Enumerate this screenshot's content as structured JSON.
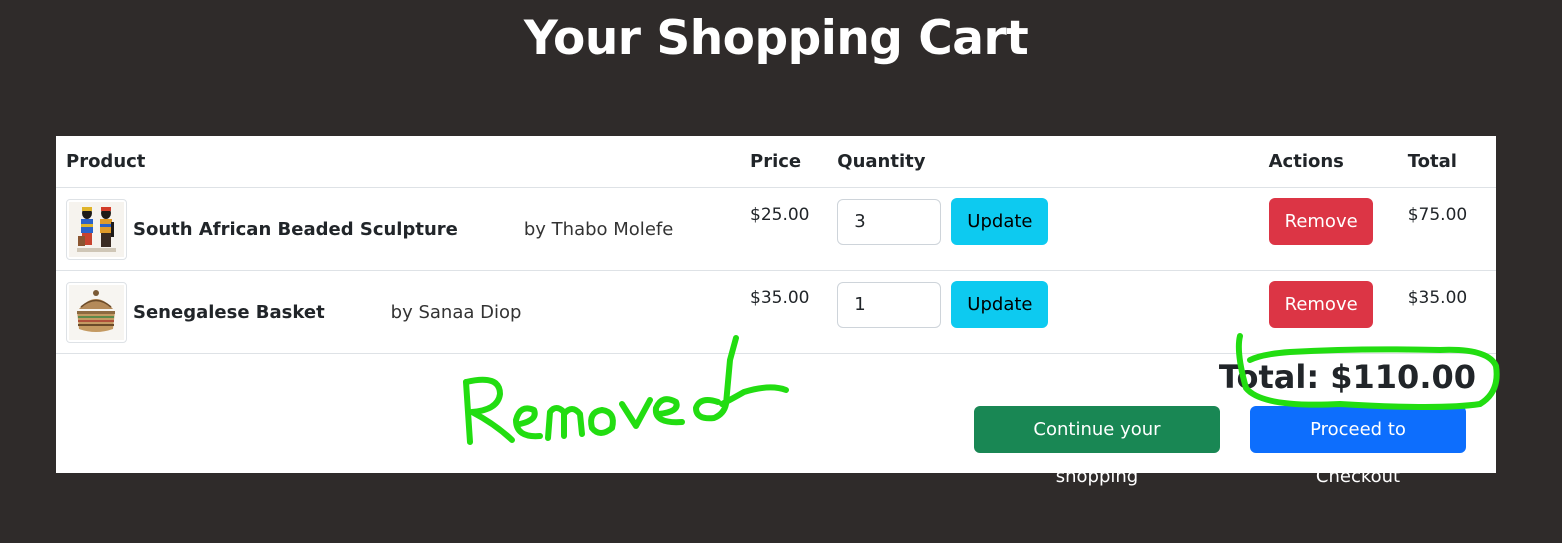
{
  "page": {
    "title": "Your Shopping Cart"
  },
  "table": {
    "headers": {
      "product": "Product",
      "price": "Price",
      "quantity": "Quantity",
      "actions": "Actions",
      "total": "Total"
    },
    "items": [
      {
        "name": "South African Beaded Sculpture",
        "author": "by Thabo Molefe",
        "price": "$25.00",
        "quantity": "3",
        "update_label": "Update",
        "remove_label": "Remove",
        "total": "$75.00"
      },
      {
        "name": "Senegalese Basket",
        "author": "by Sanaa Diop",
        "price": "$35.00",
        "quantity": "1",
        "update_label": "Update",
        "remove_label": "Remove",
        "total": "$35.00"
      }
    ]
  },
  "summary": {
    "grand_total": "Total: $110.00",
    "continue_label": "Continue your shopping",
    "checkout_label": "Proceed to Checkout"
  },
  "annotation": {
    "handwritten_text": "Removed",
    "color": "#22dd11"
  },
  "colors": {
    "background": "#2f2b2a",
    "update": "#0dcaf0",
    "remove": "#dc3545",
    "continue": "#198754",
    "checkout": "#0d6efd"
  }
}
